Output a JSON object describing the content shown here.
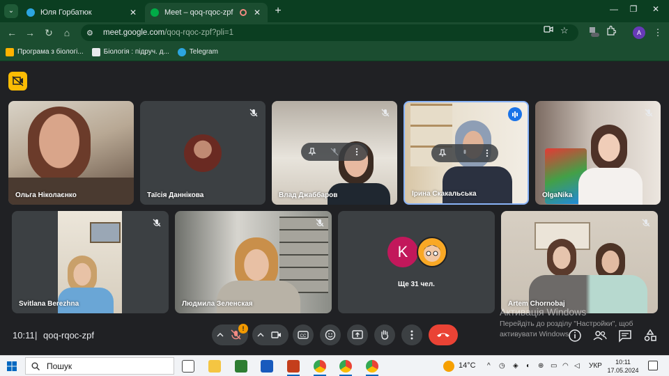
{
  "browser": {
    "tabs": [
      {
        "title": "Юля Горбатюк",
        "active": false,
        "favicon_color": "#2ca5e0"
      },
      {
        "title": "Meet – qoq-rqoc-zpf",
        "active": true,
        "favicon_color": "#00ac47"
      }
    ],
    "url_host": "meet.google.com",
    "url_path": "/qoq-rqoc-zpf?pli=1",
    "profile_initial": "A",
    "bookmarks": [
      {
        "label": "Програма з біологі...",
        "icon": "bookmark-icon"
      },
      {
        "label": "Біологія : підруч. д...",
        "icon": "page-icon"
      },
      {
        "label": "Telegram",
        "icon": "telegram-icon"
      }
    ]
  },
  "meeting": {
    "code": "qoq-rqoc-zpf",
    "time": "10:11",
    "participants": [
      {
        "name": "Ольга Ніколаєнко",
        "muted": false,
        "video": true
      },
      {
        "name": "Таїсія Даннікова",
        "muted": true,
        "video": false
      },
      {
        "name": "Влад Джаббаров",
        "muted": true,
        "video": true
      },
      {
        "name": "Ірина Скакальська",
        "muted": false,
        "video": true,
        "speaking": true
      },
      {
        "name": "OlgaNika",
        "muted": true,
        "video": true
      },
      {
        "name": "Svitlana Berezhna",
        "muted": true,
        "video": true
      },
      {
        "name": "Людмила Зеленская",
        "muted": true,
        "video": true
      },
      {
        "name": "Artem Chornobaj",
        "muted": true,
        "video": true
      }
    ],
    "more": {
      "label": "Ще 31 чел.",
      "avatar_letter": "K"
    },
    "notification_count": "!"
  },
  "watermark": {
    "line1": "Активація Windows",
    "line2": "Перейдіть до розділу \"Настройки\", щоб",
    "line3": "активувати Windows."
  },
  "taskbar": {
    "search_label": "Пошук",
    "weather": "14°C",
    "lang": "УКР",
    "time": "10:11",
    "date": "17.05.2024"
  },
  "colors": {
    "chrome_dark": "#0b3e21",
    "chrome": "#1b4d30",
    "meet_bg": "#202124",
    "tile_bg": "#3c4043",
    "end_call": "#ea4335",
    "speaking_border": "#8ab4f8"
  }
}
